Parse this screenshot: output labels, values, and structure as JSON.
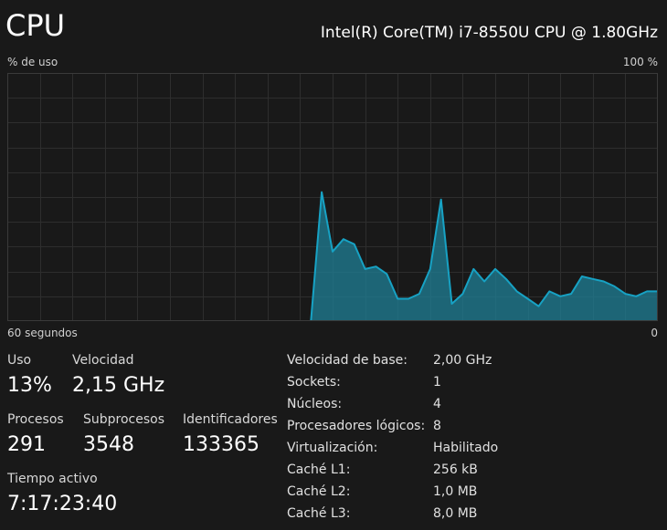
{
  "header": {
    "title": "CPU",
    "model": "Intel(R) Core(TM) i7-8550U CPU @ 1.80GHz"
  },
  "graph": {
    "y_label": "% de uso",
    "y_max_label": "100 %",
    "x_left_label": "60 segundos",
    "x_right_label": "0",
    "line_color": "#17a2c4",
    "fill_color": "#1f7f96",
    "grid_color": "#2e2e2e",
    "border_color": "#3a3a3a"
  },
  "chart_data": {
    "type": "area",
    "x": [
      60,
      59,
      58,
      57,
      56,
      55,
      54,
      53,
      52,
      51,
      50,
      49,
      48,
      47,
      46,
      45,
      44,
      43,
      42,
      41,
      40,
      39,
      38,
      37,
      36,
      35,
      34,
      33,
      32,
      31,
      30,
      29,
      28,
      27,
      26,
      25,
      24,
      23,
      22,
      21,
      20,
      19,
      18,
      17,
      16,
      15,
      14,
      13,
      12,
      11,
      10,
      9,
      8,
      7,
      6,
      5,
      4,
      3,
      2,
      1,
      0
    ],
    "values": [
      0,
      0,
      0,
      0,
      0,
      0,
      0,
      0,
      0,
      0,
      0,
      0,
      0,
      0,
      0,
      0,
      0,
      0,
      0,
      0,
      0,
      0,
      0,
      0,
      0,
      0,
      0,
      0,
      0,
      52,
      28,
      33,
      31,
      21,
      22,
      19,
      9,
      9,
      11,
      21,
      49,
      7,
      11,
      21,
      16,
      21,
      17,
      12,
      9,
      6,
      12,
      10,
      11,
      18,
      17,
      16,
      14,
      11,
      10,
      12,
      12
    ],
    "xlim": [
      60,
      0
    ],
    "ylim": [
      0,
      100
    ],
    "grid": true
  },
  "stats": {
    "uso": {
      "label": "Uso",
      "value": "13%"
    },
    "velocidad": {
      "label": "Velocidad",
      "value": "2,15 GHz"
    },
    "procesos": {
      "label": "Procesos",
      "value": "291"
    },
    "subprocesos": {
      "label": "Subprocesos",
      "value": "3548"
    },
    "identificadores": {
      "label": "Identificadores",
      "value": "133365"
    },
    "tiempo": {
      "label": "Tiempo activo",
      "value": "7:17:23:40"
    }
  },
  "specs": [
    {
      "key": "Velocidad de base:",
      "value": "2,00 GHz"
    },
    {
      "key": "Sockets:",
      "value": "1"
    },
    {
      "key": "Núcleos:",
      "value": "4"
    },
    {
      "key": "Procesadores lógicos:",
      "value": "8"
    },
    {
      "key": "Virtualización:",
      "value": "Habilitado"
    },
    {
      "key": "Caché L1:",
      "value": "256 kB"
    },
    {
      "key": "Caché L2:",
      "value": "1,0 MB"
    },
    {
      "key": "Caché L3:",
      "value": "8,0 MB"
    }
  ]
}
